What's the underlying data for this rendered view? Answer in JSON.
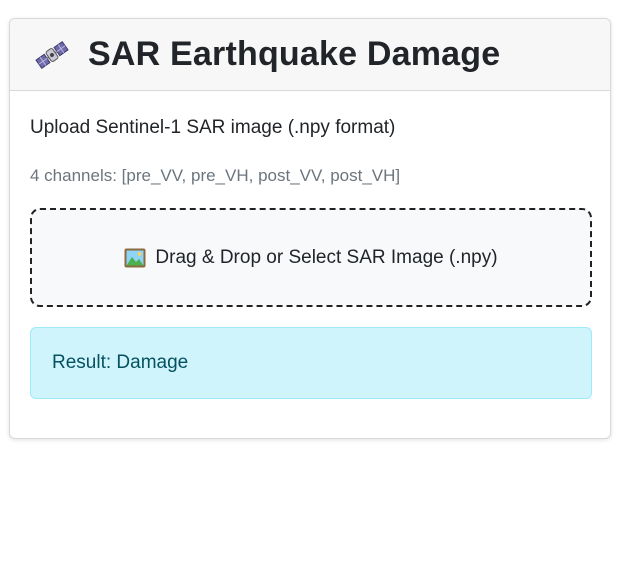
{
  "header": {
    "icon": "satellite-icon",
    "title": "SAR Earthquake Damage"
  },
  "upload": {
    "instruction": "Upload Sentinel-1 SAR image (.npy format)",
    "channels_hint": "4 channels: [pre_VV, pre_VH, post_VV, post_VH]",
    "dropzone_icon": "framed-picture-icon",
    "dropzone_label": "Drag & Drop or Select SAR Image (.npy)"
  },
  "result": {
    "text": "Result: Damage"
  },
  "colors": {
    "result_background": "#cff4fc",
    "result_text": "#055160",
    "muted_text": "#6c757d"
  }
}
